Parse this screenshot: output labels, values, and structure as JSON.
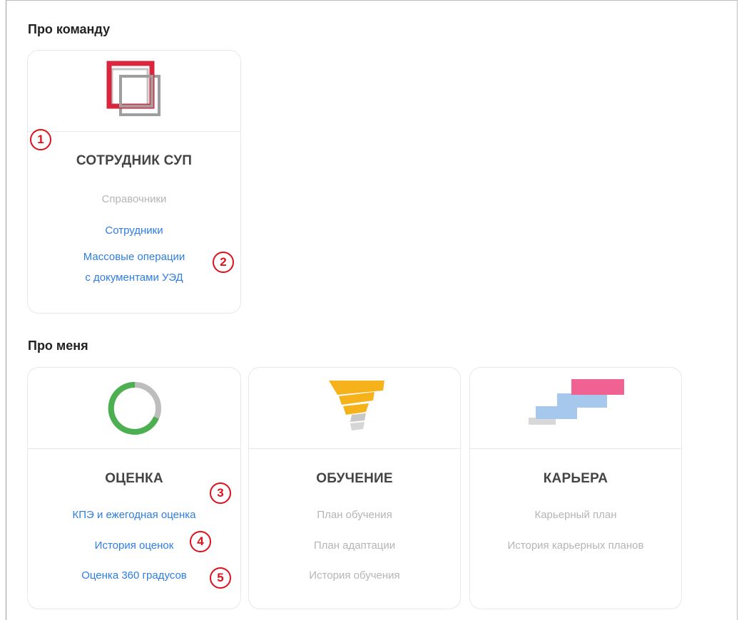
{
  "sections": {
    "team": {
      "title": "Про команду"
    },
    "me": {
      "title": "Про меня"
    }
  },
  "cards": {
    "employee": {
      "title": "СОТРУДНИК СУП",
      "icon": "overlapping-squares-icon",
      "items": [
        {
          "label": "Справочники",
          "enabled": false
        },
        {
          "label": "Сотрудники",
          "enabled": true
        },
        {
          "label": "Массовые операции",
          "enabled": true
        },
        {
          "label": "с документами УЭД",
          "enabled": true
        }
      ]
    },
    "assessment": {
      "title": "ОЦЕНКА",
      "icon": "ring-progress-icon",
      "items": [
        {
          "label": "КПЭ и ежегодная оценка",
          "enabled": true
        },
        {
          "label": "История оценок",
          "enabled": true
        },
        {
          "label": "Оценка 360 градусов",
          "enabled": true
        }
      ]
    },
    "learning": {
      "title": "ОБУЧЕНИЕ",
      "icon": "spring-icon",
      "items": [
        {
          "label": "План обучения",
          "enabled": false
        },
        {
          "label": "План адаптации",
          "enabled": false
        },
        {
          "label": "История обучения",
          "enabled": false
        }
      ]
    },
    "career": {
      "title": "КАРЬЕРА",
      "icon": "career-steps-icon",
      "items": [
        {
          "label": "Карьерный план",
          "enabled": false
        },
        {
          "label": "История карьерных планов",
          "enabled": false
        }
      ]
    }
  },
  "markers": [
    "1",
    "2",
    "3",
    "4",
    "5"
  ],
  "colors": {
    "link": "#2e7de1",
    "disabled": "#b5b5b5",
    "marker": "#e0101b",
    "brand_red": "#d7263d",
    "ring_green": "#4caf50",
    "spring_yellow": "#f6b21b",
    "career_pink": "#f06292",
    "career_blue": "#a6c8ec"
  }
}
